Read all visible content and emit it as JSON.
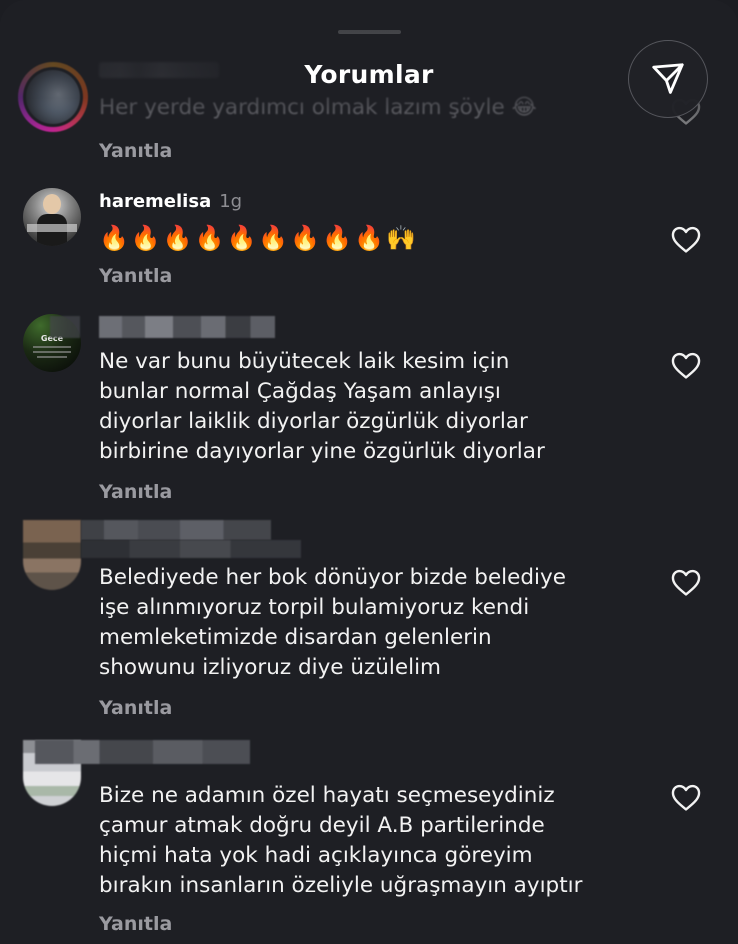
{
  "header": {
    "title": "Yorumlar"
  },
  "comments": [
    {
      "username": "",
      "time": "",
      "text": "Her yerde yardımcı olmak lazım şöyle 😂",
      "reply_label": "Yanıtla"
    },
    {
      "username": "haremelisa",
      "time": "1g",
      "text": "🔥🔥🔥🔥🔥🔥🔥🔥🔥🙌",
      "reply_label": "Yanıtla"
    },
    {
      "username": "",
      "time": "",
      "avatar_text": "Gece",
      "text": "Ne var bunu büyütecek laik kesim için\nbunlar normal Çağdaş Yaşam anlayışı\ndiyorlar laiklik diyorlar özgürlük diyorlar\nbirbirine dayıyorlar yine özgürlük diyorlar",
      "reply_label": "Yanıtla"
    },
    {
      "username": "",
      "time": "",
      "text": "Belediyede her bok dönüyor bizde belediye\nişe alınmıyoruz torpil bulamiyoruz kendi\nmemleketimizde disardan gelenlerin\nshowunu izliyoruz diye üzülelim",
      "reply_label": "Yanıtla"
    },
    {
      "username": "",
      "time": "",
      "text": "Bize ne adamın özel hayatı seçmeseydiniz\nçamur atmak doğru deyil A.B partilerinde\nhiçmi hata yok hadi açıklayınca göreyim\nbırakın insanların özeliyle uğraşmayın ayıptır",
      "reply_label": "Yanıtla"
    }
  ],
  "icons": {
    "share": "paper-plane-icon",
    "like": "heart-outline-icon"
  },
  "colors": {
    "background": "#1e1f24",
    "text": "#f2f2f2",
    "secondary": "#9a9aa0",
    "story_ring_start": "#f9a11b",
    "story_ring_end": "#d6249f"
  }
}
